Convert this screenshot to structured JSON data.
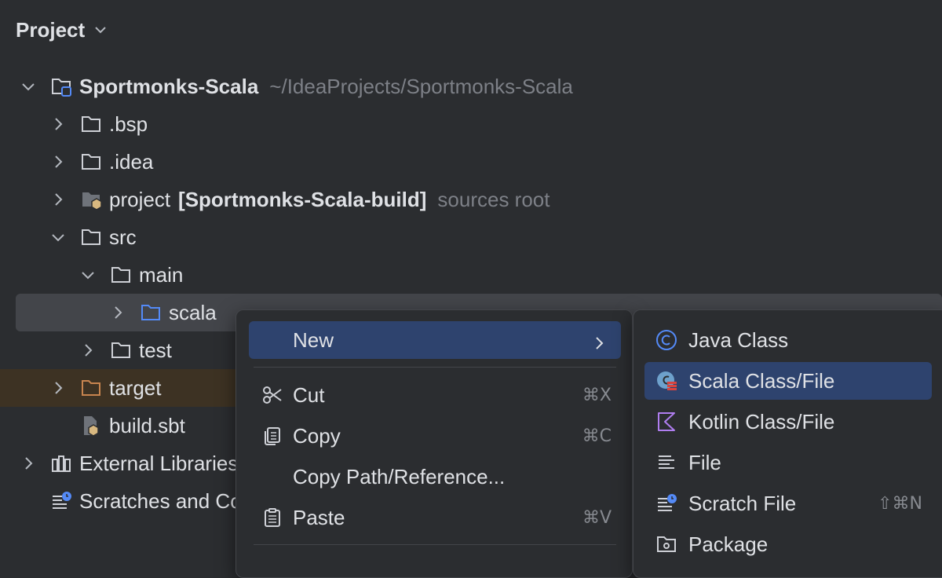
{
  "panel": {
    "title": "Project"
  },
  "tree": {
    "root": {
      "name": "Sportmonks-Scala",
      "path": "~/IdeaProjects/Sportmonks-Scala"
    },
    "bsp": ".bsp",
    "idea": ".idea",
    "project": {
      "name": "project",
      "module": "[Sportmonks-Scala-build]",
      "note": "sources root"
    },
    "src": "src",
    "main": "main",
    "scala": "scala",
    "test": "test",
    "target": "target",
    "build": "build.sbt",
    "external": "External Libraries",
    "scratches": "Scratches and Consoles"
  },
  "context_menu": {
    "new": "New",
    "cut": {
      "label": "Cut",
      "shortcut": "⌘X"
    },
    "copy": {
      "label": "Copy",
      "shortcut": "⌘C"
    },
    "copy_path": "Copy Path/Reference...",
    "paste": {
      "label": "Paste",
      "shortcut": "⌘V"
    }
  },
  "new_submenu": {
    "java_class": "Java Class",
    "scala_class": "Scala Class/File",
    "kotlin_class": "Kotlin Class/File",
    "file": "File",
    "scratch": {
      "label": "Scratch File",
      "shortcut": "⇧⌘N"
    },
    "package": "Package"
  },
  "colors": {
    "background": "#2b2d30",
    "selection": "#43454a",
    "highlight": "#2e436e",
    "excluded": "#3d3223",
    "accent_blue": "#548af7",
    "target_folder": "#c7844f"
  }
}
